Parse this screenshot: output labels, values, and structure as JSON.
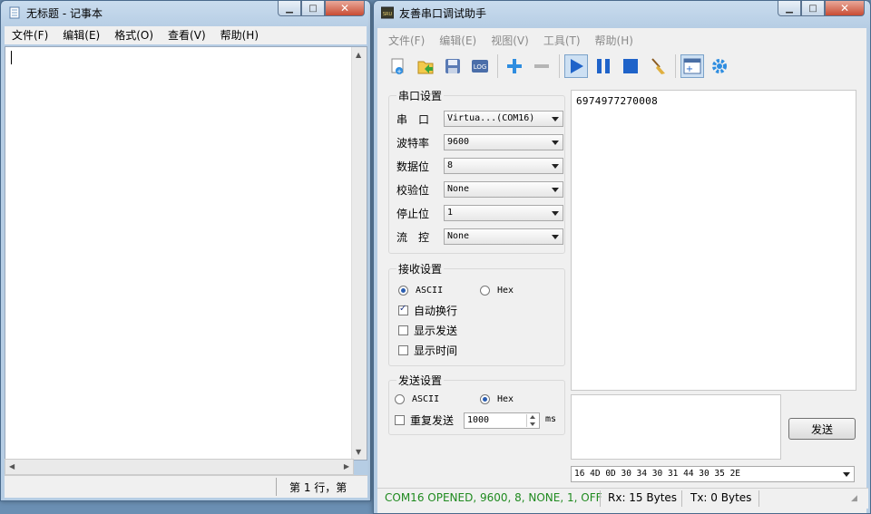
{
  "notepad": {
    "title": "无标题 - 记事本",
    "menu": [
      "文件(F)",
      "编辑(E)",
      "格式(O)",
      "查看(V)",
      "帮助(H)"
    ],
    "status": "第 1 行，第"
  },
  "serial": {
    "title": "友善串口调试助手",
    "menu": [
      "文件(F)",
      "编辑(E)",
      "视图(V)",
      "工具(T)",
      "帮助(H)"
    ],
    "toolbar_icons": [
      "new-icon",
      "open-icon",
      "save-icon",
      "log-icon",
      "add-icon",
      "remove-icon",
      "play-icon",
      "pause-icon",
      "stop-icon",
      "clear-icon",
      "new-window-icon",
      "settings-icon"
    ],
    "port_settings": {
      "title": "串口设置",
      "rows": [
        {
          "label": "串　口",
          "value": "Virtua...(COM16)"
        },
        {
          "label": "波特率",
          "value": "9600"
        },
        {
          "label": "数据位",
          "value": "8"
        },
        {
          "label": "校验位",
          "value": "None"
        },
        {
          "label": "停止位",
          "value": "1"
        },
        {
          "label": "流　控",
          "value": "None"
        }
      ]
    },
    "recv_settings": {
      "title": "接收设置",
      "ascii": "ASCII",
      "hex": "Hex",
      "auto_newline": "自动换行",
      "show_send": "显示发送",
      "show_time": "显示时间"
    },
    "send_settings": {
      "title": "发送设置",
      "ascii": "ASCII",
      "hex": "Hex",
      "repeat": "重复发送",
      "interval": "1000",
      "unit": "ms"
    },
    "recv_text": "6974977270008",
    "send_button": "发送",
    "hex_history": "16 4D 0D 30 34 30 31 44 30 35 2E",
    "status": {
      "port": "COM16 OPENED, 9600, 8, NONE, 1, OFF",
      "rx": "Rx: 15 Bytes",
      "tx": "Tx: 0 Bytes"
    },
    "colors": {
      "status_ok": "#1f8a1f",
      "play_blue": "#1f63c9"
    }
  }
}
